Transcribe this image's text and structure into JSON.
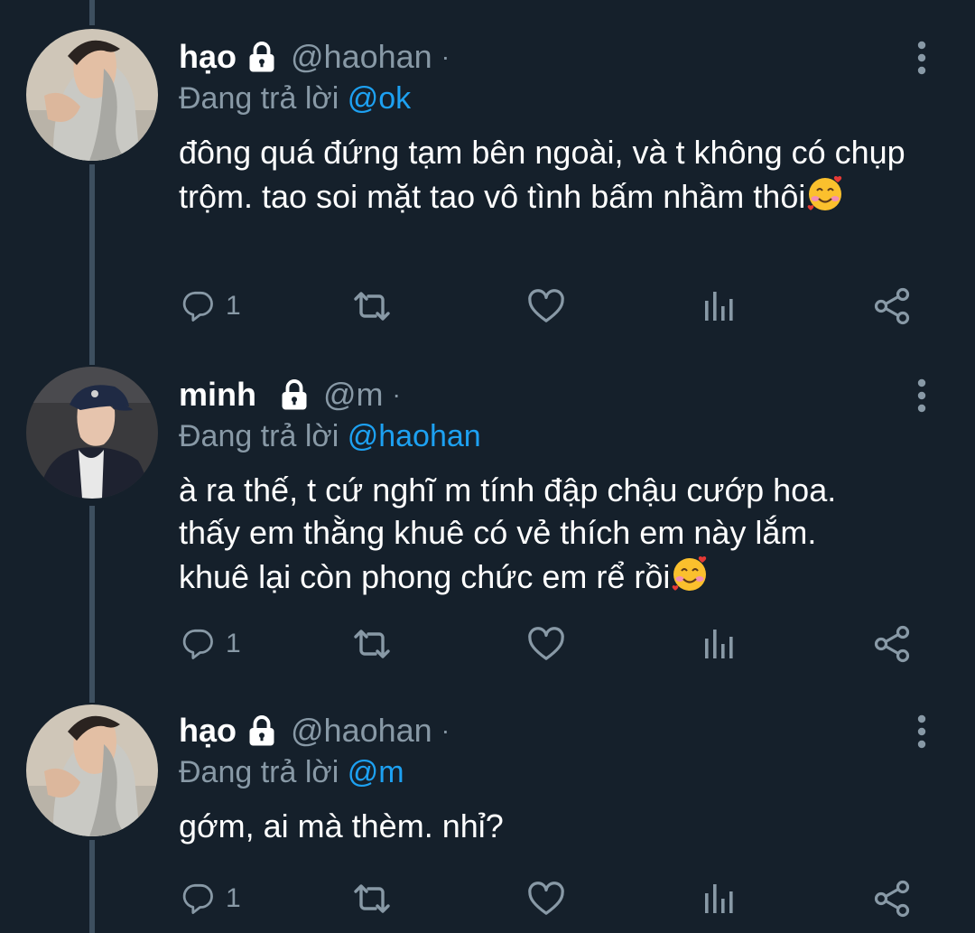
{
  "colors": {
    "background": "#15202b",
    "thread_line": "#3d4f5f",
    "secondary_text": "#8899a6",
    "mention": "#1da1f2",
    "primary_text": "#ffffff"
  },
  "tweets": [
    {
      "name": "hạo",
      "handle": "@haohan",
      "separator": "·",
      "locked": true,
      "replying_prefix": "Đang trả lời ",
      "replying_to": "@ok",
      "body_text": "đông quá đứng tạm bên ngoài, và t không có chụp trộm. tao soi mặt tao vô tình bấm nhầm thôi",
      "emoji": "smiling-face-with-hearts",
      "reply_count": "1",
      "icons": [
        "reply-icon",
        "retweet-icon",
        "like-icon",
        "analytics-icon",
        "share-icon",
        "more-options-icon"
      ]
    },
    {
      "name": "minh",
      "handle": "@m",
      "separator": "·",
      "locked": true,
      "replying_prefix": "Đang trả lời ",
      "replying_to": "@haohan",
      "body_text": "à ra thế, t cứ nghĩ m tính đập chậu cướp hoa. thấy em thằng khuê có vẻ thích em này lắm. khuê lại còn phong chức em rể rồi",
      "emoji": "smiling-face-with-hearts",
      "reply_count": "1",
      "icons": [
        "reply-icon",
        "retweet-icon",
        "like-icon",
        "analytics-icon",
        "share-icon",
        "more-options-icon"
      ]
    },
    {
      "name": "hạo",
      "handle": "@haohan",
      "separator": "·",
      "locked": true,
      "replying_prefix": "Đang trả lời ",
      "replying_to": "@m",
      "body_text": "gớm, ai mà thèm. nhỉ?",
      "emoji": "",
      "reply_count": "1",
      "icons": [
        "reply-icon",
        "retweet-icon",
        "like-icon",
        "analytics-icon",
        "share-icon",
        "more-options-icon"
      ]
    }
  ]
}
